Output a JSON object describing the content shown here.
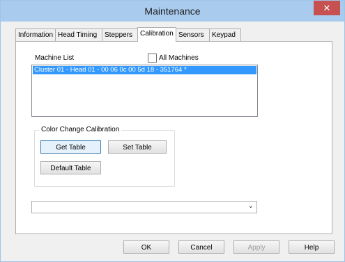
{
  "window": {
    "title": "Maintenance",
    "close_glyph": "✕"
  },
  "tabs": [
    {
      "label": "Information",
      "active": false
    },
    {
      "label": "Head Timing",
      "active": false
    },
    {
      "label": "Steppers",
      "active": false
    },
    {
      "label": "Calibration",
      "active": true
    },
    {
      "label": "Sensors",
      "active": false
    },
    {
      "label": "Keypad",
      "active": false
    }
  ],
  "calibration": {
    "machine_list_label": "Machine List",
    "all_machines_label": "All Machines",
    "all_machines_checked": false,
    "machines": [
      "Cluster 01 - Head 01 - 00 06 0c 00 5d 18 - 351764 *"
    ],
    "group_title": "Color Change Calibration",
    "get_table_label": "Get Table",
    "set_table_label": "Set Table",
    "default_table_label": "Default Table",
    "combo_value": "",
    "combo_arrow": "⌄"
  },
  "dialog_buttons": {
    "ok": "OK",
    "cancel": "Cancel",
    "apply": "Apply",
    "help": "Help"
  },
  "colors": {
    "titlebar": "#a9cbee",
    "close": "#c75050",
    "selection": "#3399ff"
  }
}
